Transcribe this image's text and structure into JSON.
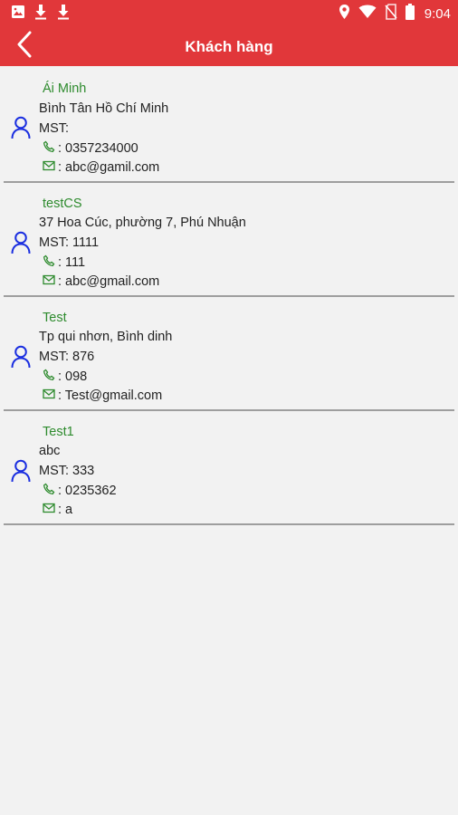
{
  "status": {
    "time": "9:04"
  },
  "header": {
    "title": "Khách hàng"
  },
  "customers": [
    {
      "name": "Ái Minh",
      "address": "Bình Tân Hồ Chí Minh",
      "mst": "MST:",
      "phone": ": 0357234000",
      "email": ": abc@gamil.com"
    },
    {
      "name": "testCS",
      "address": "37 Hoa Cúc, phường 7, Phú Nhuận",
      "mst": "MST: 1111",
      "phone": ": 111",
      "email": ": abc@gmail.com"
    },
    {
      "name": "Test",
      "address": "Tp qui nhơn, Bình dinh",
      "mst": "MST: 876",
      "phone": ": 098",
      "email": ": Test@gmail.com"
    },
    {
      "name": "Test1",
      "address": "abc",
      "mst": "MST: 333",
      "phone": ": 0235362",
      "email": ": a"
    }
  ],
  "icons": {
    "status": [
      "image-icon",
      "download-icon",
      "download-icon",
      "location-icon",
      "wifi-icon",
      "no-sim-icon",
      "battery-icon"
    ],
    "back": "back-arrow-icon",
    "person": "person-icon",
    "phone": "phone-icon",
    "email": "email-icon"
  },
  "colors": {
    "appbar": "#e1373a",
    "name": "#2e8b2e",
    "person_icon": "#1a2ee0",
    "divider": "#9e9e9e",
    "background": "#f2f2f2"
  }
}
